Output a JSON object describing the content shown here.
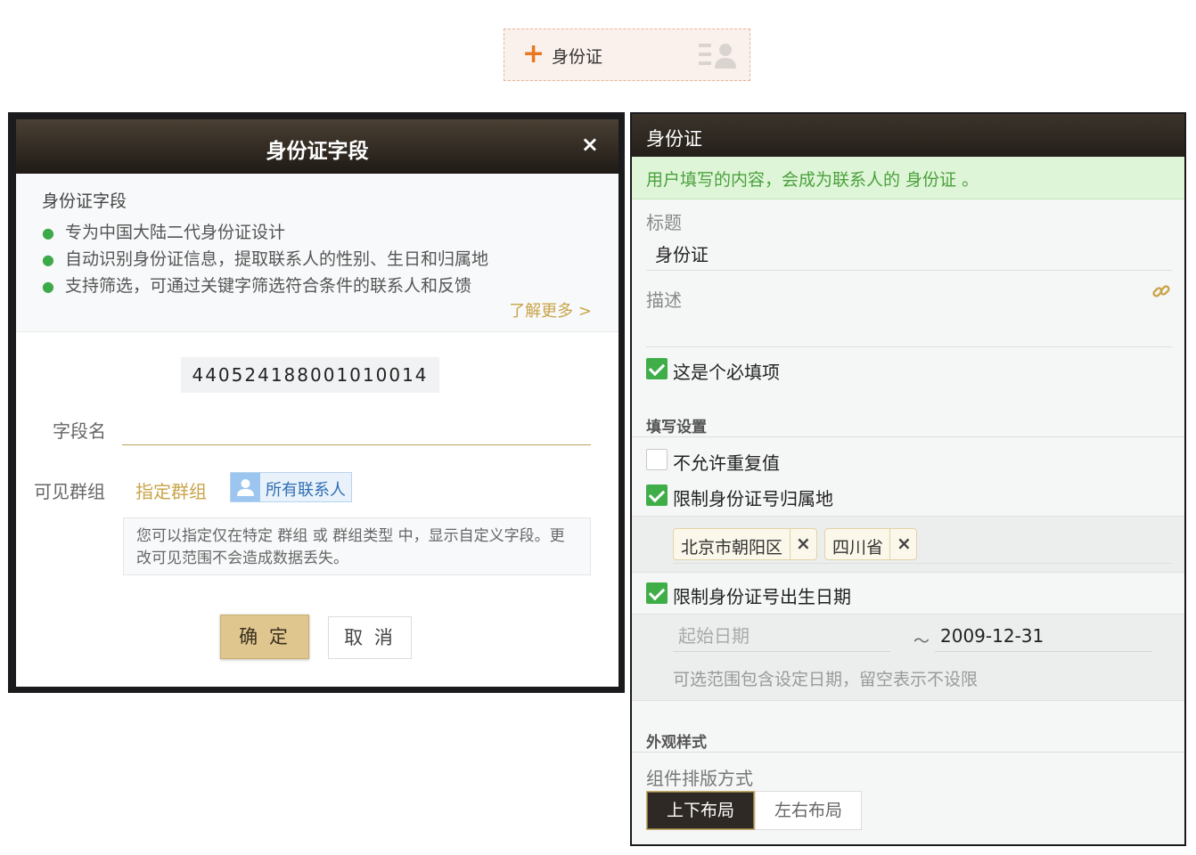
{
  "chip": {
    "label": "身份证",
    "plus": "+"
  },
  "dialog": {
    "title": "身份证字段",
    "close": "×",
    "info_title": "身份证字段",
    "bullets": [
      "专为中国大陆二代身份证设计",
      "自动识别身份证信息，提取联系人的性别、生日和归属地",
      "支持筛选，可通过关键字筛选符合条件的联系人和反馈"
    ],
    "learn_more": "了解更多 >",
    "sample_id": "440524188001010014",
    "field_name_label": "字段名",
    "field_name_value": "",
    "visible_group_label": "可见群组",
    "assign_group_link": "指定群组",
    "all_contacts_tag": "所有联系人",
    "hint": "您可以指定仅在特定 群组 或 群组类型 中，显示自定义字段。更改可见范围不会造成数据丢失。",
    "ok_button": "确 定",
    "cancel_button": "取 消"
  },
  "panel": {
    "title": "身份证",
    "notice": "用户填写的内容，会成为联系人的 身份证 。",
    "title_label": "标题",
    "title_value": "身份证",
    "desc_label": "描述",
    "required_label": "这是个必填项",
    "required_checked": true,
    "fill_settings": "填写设置",
    "no_duplicate_label": "不允许重复值",
    "no_duplicate_checked": false,
    "restrict_region_label": "限制身份证号归属地",
    "restrict_region_checked": true,
    "regions": [
      "北京市朝阳区",
      "四川省"
    ],
    "restrict_birth_label": "限制身份证号出生日期",
    "restrict_birth_checked": true,
    "start_date_placeholder": "起始日期",
    "date_separator": "～",
    "end_date_value": "2009-12-31",
    "date_hint": "可选范围包含设定日期，留空表示不设限",
    "appearance": "外观样式",
    "layout_label": "组件排版方式",
    "layout_options": [
      "上下布局",
      "左右布局"
    ],
    "layout_selected": "上下布局"
  },
  "colors": {
    "accent_gold": "#c9a449",
    "success_green": "#3fae49",
    "header_dark": "#241f1a",
    "plus_orange": "#e8771f"
  }
}
